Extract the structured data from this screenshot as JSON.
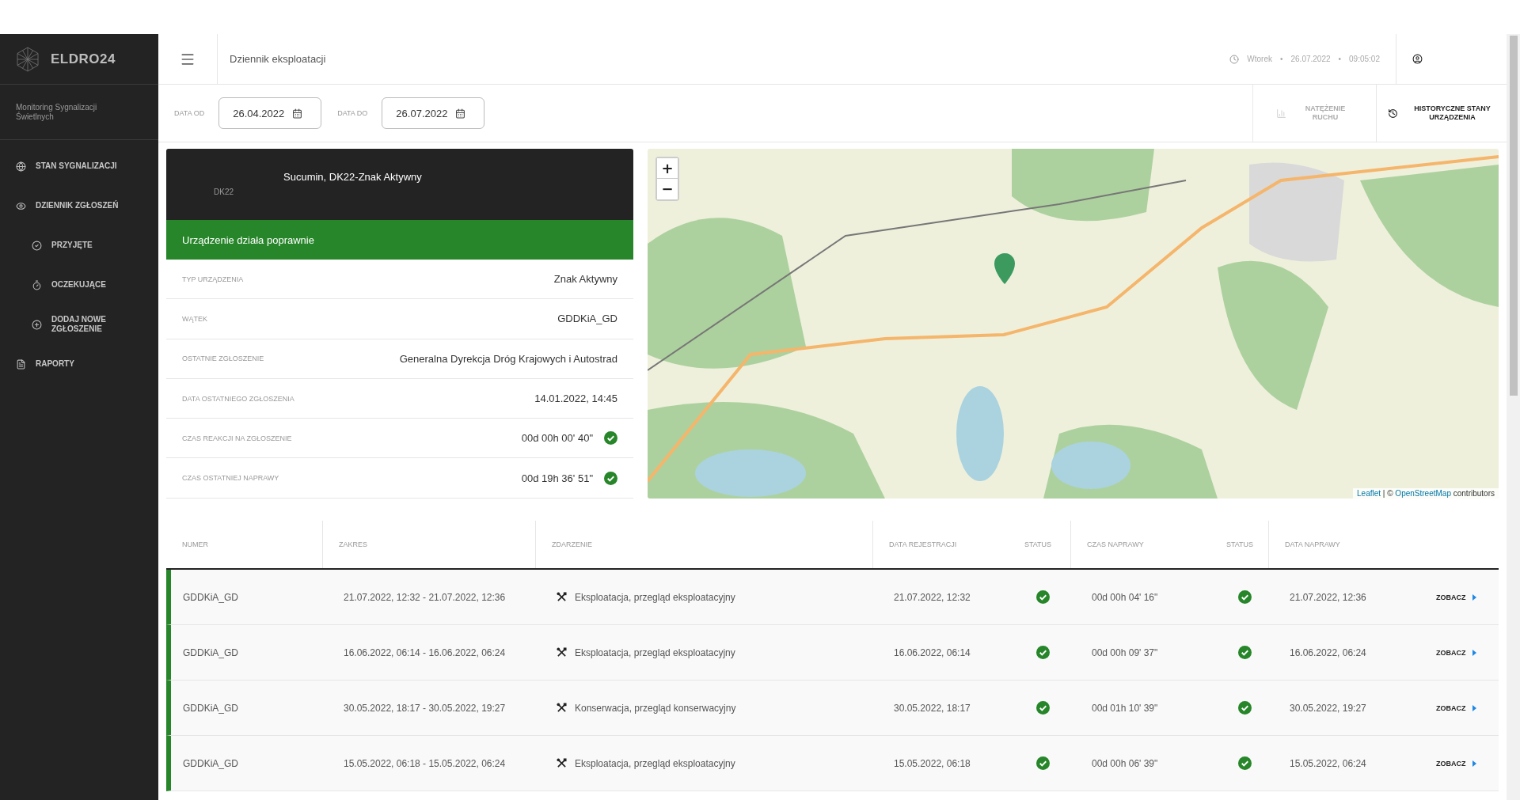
{
  "sidebar": {
    "brand": "ELDRO24",
    "subtitle": "Monitoring Sygnalizacji Świetlnych",
    "items": [
      {
        "label": "STAN SYGNALIZACJI"
      },
      {
        "label": "DZIENNIK ZGŁOSZEŃ",
        "children": [
          {
            "label": "PRZYJĘTE"
          },
          {
            "label": "OCZEKUJĄCE"
          },
          {
            "label": "DODAJ NOWE ZGŁOSZENIE"
          }
        ]
      },
      {
        "label": "RAPORTY"
      }
    ]
  },
  "header": {
    "title": "Dziennik eksploatacji",
    "day": "Wtorek",
    "separator_1": "•",
    "date": "26.07.2022",
    "separator_2": "•",
    "time": "09:05:02"
  },
  "filters": [
    {
      "label": "DATA OD",
      "value": "26.04.2022"
    },
    {
      "label": "DATA DO",
      "value": "26.07.2022"
    }
  ],
  "actions": [
    {
      "label": "NATĘŻENIE RUCHU",
      "disabled": true
    },
    {
      "label": "HISTORYCZNE STANY URZĄDZENIA",
      "disabled": false
    }
  ],
  "device": {
    "title": "Sucumin, DK22-Znak Aktywny",
    "road": "DK22",
    "status": "Urządzenie działa poprawnie",
    "rows": [
      {
        "label": "TYP URZĄDZENIA",
        "value": "Znak Aktywny"
      },
      {
        "label": "WĄTEK",
        "value": "GDDKiA_GD"
      },
      {
        "label": "OSTATNIE ZGŁOSZENIE",
        "value": "Generalna Dyrekcja Dróg Krajowych i Autostrad"
      },
      {
        "label": "DATA OSTATNIEGO ZGŁOSZENIA",
        "value": "14.01.2022, 14:45"
      },
      {
        "label": "CZAS REAKCJI NA ZGŁOSZENIE",
        "value": "00d 00h 00' 40\"",
        "ok": true
      },
      {
        "label": "CZAS OSTATNIEJ NAPRAWY",
        "value": "00d 19h 36' 51\"",
        "ok": true
      }
    ]
  },
  "map": {
    "zoom_in": "+",
    "zoom_out": "−",
    "attribution": {
      "link_1": "Leaflet",
      "middle": "| ©",
      "link_2": "OpenStreetMap",
      "suffix": "contributors"
    }
  },
  "table": {
    "columns": [
      "NUMER",
      "ZAKRES",
      "ZDARZENIE",
      "DATA REJESTRACJI",
      "STATUS",
      "CZAS NAPRAWY",
      "STATUS",
      "DATA NAPRAWY"
    ],
    "rows": [
      {
        "numer": "GDDKiA_GD",
        "zakres": "21.07.2022, 12:32 - 21.07.2022, 12:36",
        "zdarzenie": "Eksploatacja, przegląd eksploatacyjny",
        "data_rejestracji": "21.07.2022, 12:32",
        "status_1_ok": true,
        "czas_naprawy": "00d 00h 04' 16\"",
        "status_2_ok": true,
        "data_naprawy": "21.07.2022, 12:36",
        "action": "ZOBACZ"
      },
      {
        "numer": "GDDKiA_GD",
        "zakres": "16.06.2022, 06:14 - 16.06.2022, 06:24",
        "zdarzenie": "Eksploatacja, przegląd eksploatacyjny",
        "data_rejestracji": "16.06.2022, 06:14",
        "status_1_ok": true,
        "czas_naprawy": "00d 00h 09' 37\"",
        "status_2_ok": true,
        "data_naprawy": "16.06.2022, 06:24",
        "action": "ZOBACZ"
      },
      {
        "numer": "GDDKiA_GD",
        "zakres": "30.05.2022, 18:17 - 30.05.2022, 19:27",
        "zdarzenie": "Konserwacja, przegląd konserwacyjny",
        "data_rejestracji": "30.05.2022, 18:17",
        "status_1_ok": true,
        "czas_naprawy": "00d 01h 10' 39\"",
        "status_2_ok": true,
        "data_naprawy": "30.05.2022, 19:27",
        "action": "ZOBACZ"
      },
      {
        "numer": "GDDKiA_GD",
        "zakres": "15.05.2022, 06:18 - 15.05.2022, 06:24",
        "zdarzenie": "Eksploatacja, przegląd eksploatacyjny",
        "data_rejestracji": "15.05.2022, 06:18",
        "status_1_ok": true,
        "czas_naprawy": "00d 00h 06' 39\"",
        "status_2_ok": true,
        "data_naprawy": "15.05.2022, 06:24",
        "action": "ZOBACZ"
      }
    ]
  }
}
